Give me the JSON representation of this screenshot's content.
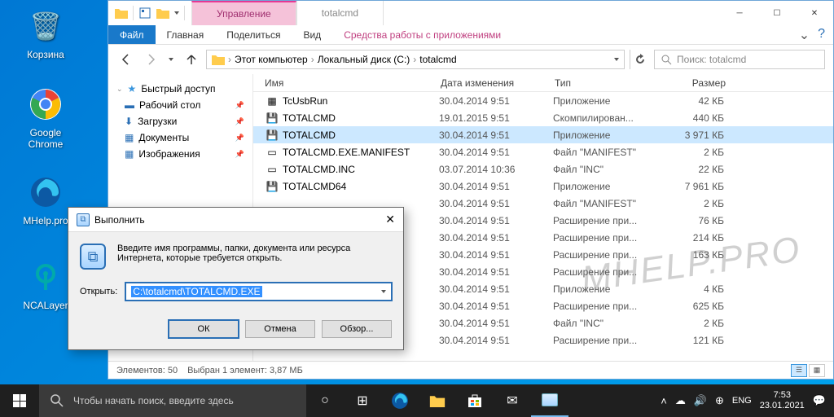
{
  "desktop": {
    "icons": [
      {
        "label": "Корзина"
      },
      {
        "label": "Google Chrome"
      },
      {
        "label": "MHelp.pro"
      },
      {
        "label": "NCALayer"
      }
    ]
  },
  "explorer": {
    "title_context": "Управление",
    "title_name": "totalcmd",
    "ribbon": {
      "file": "Файл",
      "tabs": [
        "Главная",
        "Поделиться",
        "Вид"
      ],
      "context_tab": "Средства работы с приложениями"
    },
    "breadcrumb": [
      "Этот компьютер",
      "Локальный диск (C:)",
      "totalcmd"
    ],
    "search_placeholder": "Поиск: totalcmd",
    "nav_pane": {
      "quick_access": "Быстрый доступ",
      "items": [
        {
          "label": "Рабочий стол",
          "pinned": true
        },
        {
          "label": "Загрузки",
          "pinned": true
        },
        {
          "label": "Документы",
          "pinned": true
        },
        {
          "label": "Изображения",
          "pinned": true
        }
      ]
    },
    "columns": {
      "name": "Имя",
      "date": "Дата изменения",
      "type": "Тип",
      "size": "Размер"
    },
    "rows": [
      {
        "name": "TcUsbRun",
        "date": "30.04.2014 9:51",
        "type": "Приложение",
        "size": "42 КБ",
        "icon": "app"
      },
      {
        "name": "TOTALCMD",
        "date": "19.01.2015 9:51",
        "type": "Скомпилирован...",
        "size": "440 КБ",
        "icon": "disk"
      },
      {
        "name": "TOTALCMD",
        "date": "30.04.2014 9:51",
        "type": "Приложение",
        "size": "3 971 КБ",
        "icon": "disk",
        "selected": true
      },
      {
        "name": "TOTALCMD.EXE.MANIFEST",
        "date": "30.04.2014 9:51",
        "type": "Файл \"MANIFEST\"",
        "size": "2 КБ",
        "icon": "file"
      },
      {
        "name": "TOTALCMD.INC",
        "date": "03.07.2014 10:36",
        "type": "Файл \"INC\"",
        "size": "22 КБ",
        "icon": "file"
      },
      {
        "name": "TOTALCMD64",
        "date": "30.04.2014 9:51",
        "type": "Приложение",
        "size": "7 961 КБ",
        "icon": "disk"
      },
      {
        "name": "",
        "date": "30.04.2014 9:51",
        "type": "Файл \"MANIFEST\"",
        "size": "2 КБ",
        "icon": ""
      },
      {
        "name": "",
        "date": "30.04.2014 9:51",
        "type": "Расширение при...",
        "size": "76 КБ",
        "icon": ""
      },
      {
        "name": "",
        "date": "30.04.2014 9:51",
        "type": "Расширение при...",
        "size": "214 КБ",
        "icon": ""
      },
      {
        "name": "",
        "date": "30.04.2014 9:51",
        "type": "Расширение при...",
        "size": "163 КБ",
        "icon": ""
      },
      {
        "name": "",
        "date": "30.04.2014 9:51",
        "type": "Расширение при...",
        "size": "",
        "icon": ""
      },
      {
        "name": "",
        "date": "30.04.2014 9:51",
        "type": "Приложение",
        "size": "4 КБ",
        "icon": ""
      },
      {
        "name": "",
        "date": "30.04.2014 9:51",
        "type": "Расширение при...",
        "size": "625 КБ",
        "icon": ""
      },
      {
        "name": "",
        "date": "30.04.2014 9:51",
        "type": "Файл \"INC\"",
        "size": "2 КБ",
        "icon": ""
      },
      {
        "name": "",
        "date": "30.04.2014 9:51",
        "type": "Расширение при...",
        "size": "121 КБ",
        "icon": ""
      }
    ],
    "status": {
      "items": "Элементов: 50",
      "selected": "Выбран 1 элемент: 3,87 МБ"
    }
  },
  "run": {
    "title": "Выполнить",
    "prompt": "Введите имя программы, папки, документа или ресурса Интернета, которые требуется открыть.",
    "open_label": "Открыть:",
    "value": "C:\\totalcmd\\TOTALCMD.EXE",
    "buttons": {
      "ok": "ОК",
      "cancel": "Отмена",
      "browse": "Обзор..."
    }
  },
  "taskbar": {
    "search_placeholder": "Чтобы начать поиск, введите здесь",
    "lang": "ENG",
    "time": "7:53",
    "date": "23.01.2021"
  },
  "watermark": "MHELP.PRO"
}
